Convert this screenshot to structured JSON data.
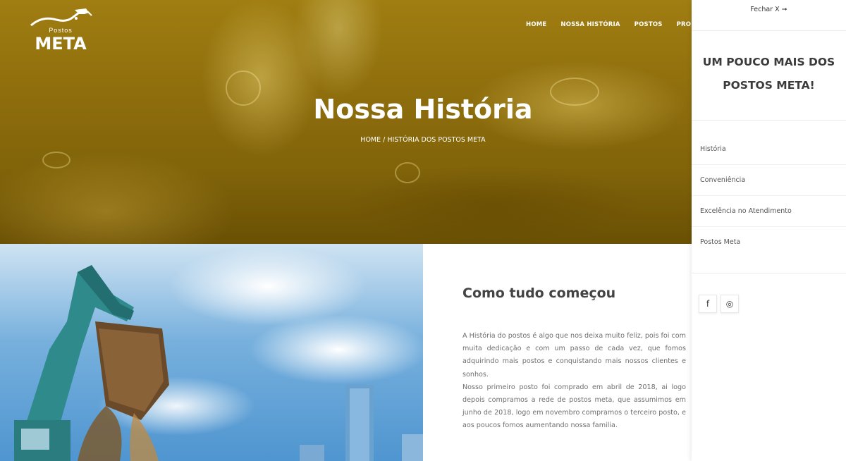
{
  "brand": {
    "small": "Postos",
    "big": "META"
  },
  "nav": [
    "HOME",
    "NOSSA HISTÓRIA",
    "POSTOS",
    "PROMOÇ"
  ],
  "hero": {
    "title": "Nossa História",
    "breadcrumb": {
      "home": "HOME",
      "separator": "/",
      "current": "HISTÓRIA DOS POSTOS META"
    }
  },
  "about": {
    "title": "Como tudo começou",
    "paragraph1": "A História do postos é algo que nos deixa muito feliz, pois foi com muita dedicação e com um passo de cada vez, que fomos adquirindo mais postos e conquistando mais nossos clientes e sonhos.",
    "paragraph2": "Nosso primeiro posto foi comprado em abril de 2018, ai logo depois compramos a rede de postos meta, que assumimos em junho de 2018, logo em novembro compramos o terceiro posto, e aos poucos fomos aumentando nossa familia."
  },
  "panel": {
    "close_label": "Fechar X ➞",
    "heading_line1": "UM POUCO MAIS DOS",
    "heading_line2": "POSTOS META!",
    "links": [
      "História",
      "Conveniência",
      "Excelência no Atendimento",
      "Postos Meta"
    ],
    "socials": [
      {
        "icon": "facebook-icon",
        "glyph": "f"
      },
      {
        "icon": "instagram-icon",
        "glyph": "◎"
      }
    ]
  },
  "colors": {
    "accent": "#9a7610",
    "heading": "#444444",
    "body_text": "#6f6f6f"
  }
}
